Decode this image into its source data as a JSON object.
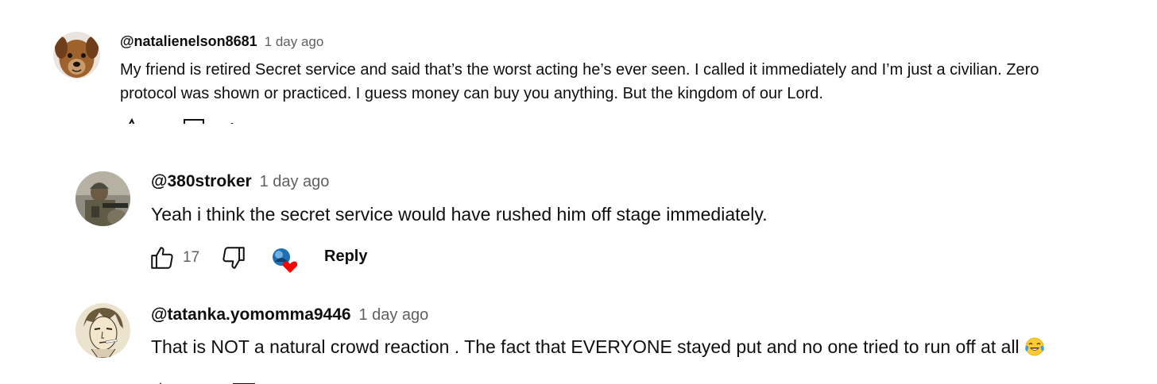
{
  "comments": [
    {
      "author": "@natalienelson8681",
      "time": "1 day ago",
      "text": "My friend is retired Secret service and said that’s the worst acting he’s ever seen. I called it immediately and I’m just a civilian. Zero protocol was shown or practiced. I guess money can buy you anything. But the kingdom of our Lord.",
      "avatar_icon": "dog-avatar"
    },
    {
      "author": "@380stroker",
      "time": "1 day ago",
      "text": "Yeah i think the secret service would have rushed him off stage immediately.",
      "avatar_icon": "soldier-avatar",
      "likes": "17",
      "reply_label": "Reply",
      "creator_heart": true
    },
    {
      "author": "@tatanka.yomomma9446",
      "time": "1 day ago",
      "text": "That is NOT a natural crowd reaction . The fact that EVERYONE stayed put and no one tried to run off at all",
      "emoji": "tears-of-joy-emoji",
      "avatar_icon": "anime-portrait-avatar"
    }
  ],
  "colors": {
    "text": "#0f0f0f",
    "secondary": "#606060",
    "heart": "#ff0000"
  }
}
